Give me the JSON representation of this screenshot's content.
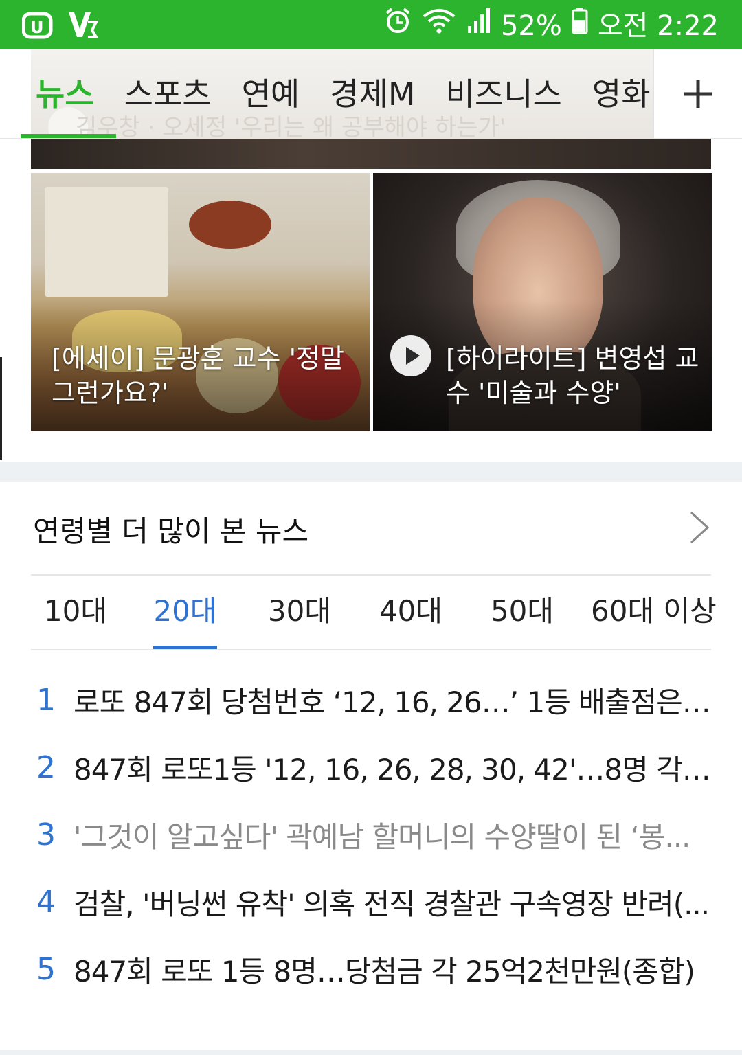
{
  "status_bar": {
    "left_icons": [
      "U+",
      "V"
    ],
    "alarm_icon": "alarm-clock-icon",
    "wifi_icon": "wifi-icon",
    "signal_icon": "signal-icon",
    "battery_percent": "52%",
    "battery_icon": "battery-icon",
    "time": "오전 2:22",
    "color": "#2db42e"
  },
  "tabs": {
    "items": [
      "뉴스",
      "스포츠",
      "연예",
      "경제M",
      "비즈니스",
      "영화"
    ],
    "active_index": 0,
    "background_caption": "김우창 · 오세정 '우리는 왜 공부해야 하는가'",
    "add_label": "+"
  },
  "cards": [
    {
      "title": "[에세이] 문광훈 교수 '정말 그런가요?'",
      "has_play": false
    },
    {
      "title": "[하이라이트] 변영섭 교수 '미술과 수양'",
      "has_play": true
    }
  ],
  "age_section": {
    "title": "연령별 더 많이 본 뉴스",
    "tabs": [
      "10대",
      "20대",
      "30대",
      "40대",
      "50대",
      "60대 이상"
    ],
    "active_index": 1,
    "accent_color": "#2f72d0"
  },
  "ranking": [
    {
      "rank": "1",
      "title": "로또 847회 당첨번호 ‘12, 16, 26…’ 1등 배출점은 ...",
      "read": false
    },
    {
      "rank": "2",
      "title": "847회 로또1등 '12, 16, 26, 28, 30, 42'…8명 각 25...",
      "read": false
    },
    {
      "rank": "3",
      "title": "'그것이 알고싶다' 곽예남 할머니의 수양딸이 된 ‘봉...",
      "read": true
    },
    {
      "rank": "4",
      "title": "검찰, '버닝썬 유착' 의혹 전직 경찰관 구속영장 반려(...",
      "read": false
    },
    {
      "rank": "5",
      "title": "847회 로또 1등 8명…당첨금 각 25억2천만원(종합)",
      "read": false
    }
  ]
}
